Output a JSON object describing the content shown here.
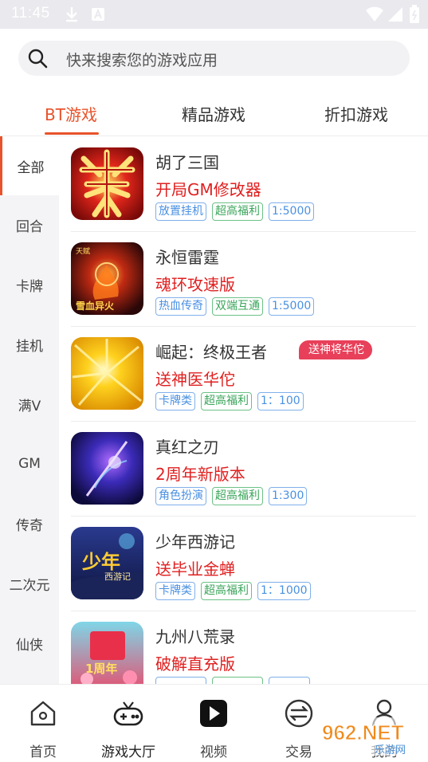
{
  "status_bar": {
    "time": "11:45"
  },
  "search": {
    "placeholder": "快来搜索您的游戏应用"
  },
  "top_tabs": [
    {
      "label": "BT游戏",
      "active": true
    },
    {
      "label": "精品游戏",
      "active": false
    },
    {
      "label": "折扣游戏",
      "active": false
    }
  ],
  "categories": [
    {
      "label": "全部",
      "active": true
    },
    {
      "label": "回合"
    },
    {
      "label": "卡牌"
    },
    {
      "label": "挂机"
    },
    {
      "label": "满V"
    },
    {
      "label": "GM"
    },
    {
      "label": "传奇"
    },
    {
      "label": "二次元"
    },
    {
      "label": "仙侠"
    }
  ],
  "games": [
    {
      "name": "胡了三国",
      "promo": "开局GM修改器",
      "icon": "game-icon-shuang",
      "tags": [
        {
          "text": "放置挂机",
          "color": "blue"
        },
        {
          "text": "超高福利",
          "color": "green"
        },
        {
          "text": "1:5000",
          "color": "blue"
        }
      ]
    },
    {
      "name": "永恒雷霆",
      "promo": "魂环攻速版",
      "icon": "game-icon-fire",
      "icon_text": {
        "top": "天赋",
        "bottom": "雪血异火"
      },
      "tags": [
        {
          "text": "热血传奇",
          "color": "blue"
        },
        {
          "text": "双端互通",
          "color": "green"
        },
        {
          "text": "1:5000",
          "color": "blue"
        }
      ]
    },
    {
      "name": "崛起：终极王者",
      "promo": "送神医华佗",
      "icon": "game-icon-gold-burst",
      "ribbon": "送神将华佗",
      "tags": [
        {
          "text": "卡牌类",
          "color": "blue"
        },
        {
          "text": "超高福利",
          "color": "green"
        },
        {
          "text": "1：100",
          "color": "blue"
        }
      ]
    },
    {
      "name": "真红之刃",
      "promo": "2周年新版本",
      "icon": "game-icon-purple-swordsman",
      "tags": [
        {
          "text": "角色扮演",
          "color": "blue"
        },
        {
          "text": "超高福利",
          "color": "green"
        },
        {
          "text": "1:300",
          "color": "blue"
        }
      ]
    },
    {
      "name": "少年西游记",
      "promo": "送毕业金蝉",
      "icon": "game-icon-journey-west",
      "icon_text": {
        "top": "少年",
        "bottom": "西游记"
      },
      "tags": [
        {
          "text": "卡牌类",
          "color": "blue"
        },
        {
          "text": "超高福利",
          "color": "green"
        },
        {
          "text": "1：1000",
          "color": "blue"
        }
      ]
    },
    {
      "name": "九州八荒录",
      "promo": "破解直充版",
      "icon": "game-icon-anniversary",
      "icon_text": {
        "top": "",
        "bottom": "1周年"
      },
      "tags": [
        {
          "text": "",
          "color": "blue"
        },
        {
          "text": "",
          "color": "green"
        },
        {
          "text": "",
          "color": "blue"
        }
      ]
    }
  ],
  "bottom_nav": [
    {
      "label": "首页",
      "icon": "home-icon"
    },
    {
      "label": "游戏大厅",
      "icon": "gamepad-icon",
      "active": true
    },
    {
      "label": "视频",
      "icon": "video-play-icon"
    },
    {
      "label": "交易",
      "icon": "exchange-icon"
    },
    {
      "label": "我的",
      "icon": "user-icon"
    }
  ],
  "watermark": {
    "brand": "962.NET",
    "sub": "乐游网"
  },
  "colors": {
    "accent": "#e8532b",
    "promo": "#e02020",
    "tag_blue": "#4a90e2",
    "tag_green": "#3aa55a",
    "ribbon": "#e8405a"
  }
}
